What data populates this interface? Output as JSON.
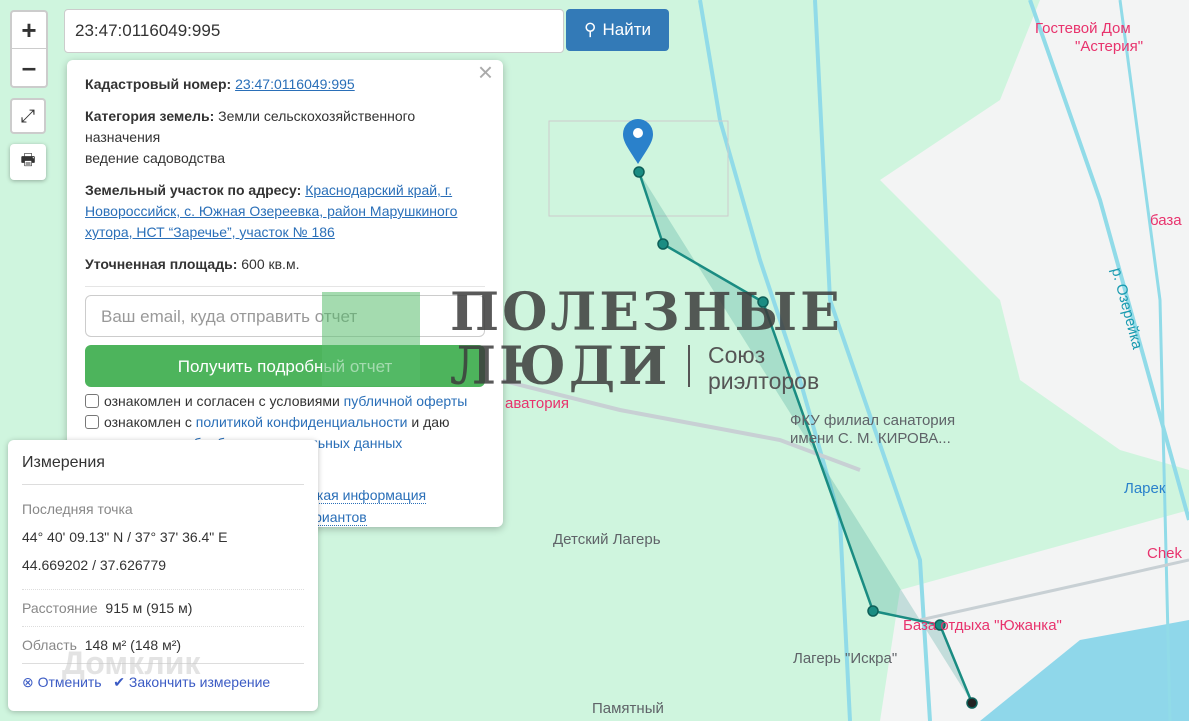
{
  "search": {
    "value": "23:47:0116049:995",
    "button": "Найти",
    "icon": "search-icon"
  },
  "controls": {
    "zoom_in": "+",
    "zoom_out": "–",
    "fullscreen_icon": "expand-icon",
    "print_icon": "print-icon"
  },
  "popup": {
    "close": "×",
    "cadastral_label": "Кадастровый номер:",
    "cadastral_value": "23:47:0116049:995",
    "category_label": "Категория земель:",
    "category_value": "Земли сельскохозяйственного назначения",
    "use": "ведение садоводства",
    "address_label": "Земельный участок по адресу:",
    "address_value": "Краснодарский край, г. Новороссийск, с. Южная Озереевка, район Марушкиного хутора, НСТ “Заречье”, участок № 186",
    "area_label": "Уточненная площадь:",
    "area_value": "600 кв.м.",
    "email_placeholder": "Ваш email, куда отправить отчет",
    "get_report": "Получить подробный отчет",
    "cb1_text": "ознакомлен и согласен с условиями ",
    "cb1_link": "публичной оферты",
    "cb2_text": "ознакомлен с ",
    "cb2_link": "политикой конфиденциальности",
    "cb2_text2": " и даю",
    "cb2_link2": "согласие на обработку персональных данных",
    "details_link": "Детали отчета и юридическая информация",
    "manual_link": "Ручной выбор вариантов"
  },
  "measure": {
    "title": "Измерения",
    "last_label": "Последняя точка",
    "dms": "44° 40' 09.13\" N / 37° 37' 36.4\" E",
    "decimal": "44.669202 / 37.626779",
    "distance_label": "Расстояние",
    "distance_value": "915 м (915 м)",
    "area_label": "Область",
    "area_value": "148 м² (148 м²)",
    "cancel": "Отменить",
    "finish": "Закончить измерение"
  },
  "map_labels": {
    "guest_house": "Гостевой Дом",
    "guest_house2": "\"Астерия\"",
    "baza": "база",
    "river": "р. Озерейка",
    "sanatoria": "аватория",
    "fku1": "ФКУ филиал санатория",
    "fku2": "имени С. М. КИРОВА...",
    "larek": "Ларек",
    "camp": "Детский Лагерь",
    "chek": "Chek",
    "yuzhanka": "База отдыха \"Южанка\"",
    "iskra": "Лагерь \"Искра\"",
    "pamyat": "Памятный"
  },
  "watermark": {
    "line1": "ПОЛЕЗНЫЕ",
    "line2": "ЛЮДИ",
    "sub1": "Союз",
    "sub2": "риэлторов",
    "domclick": "Домклик"
  },
  "colors": {
    "accent": "#337ab7",
    "green_button": "#4db45c",
    "measure_line": "#1a8c82"
  }
}
